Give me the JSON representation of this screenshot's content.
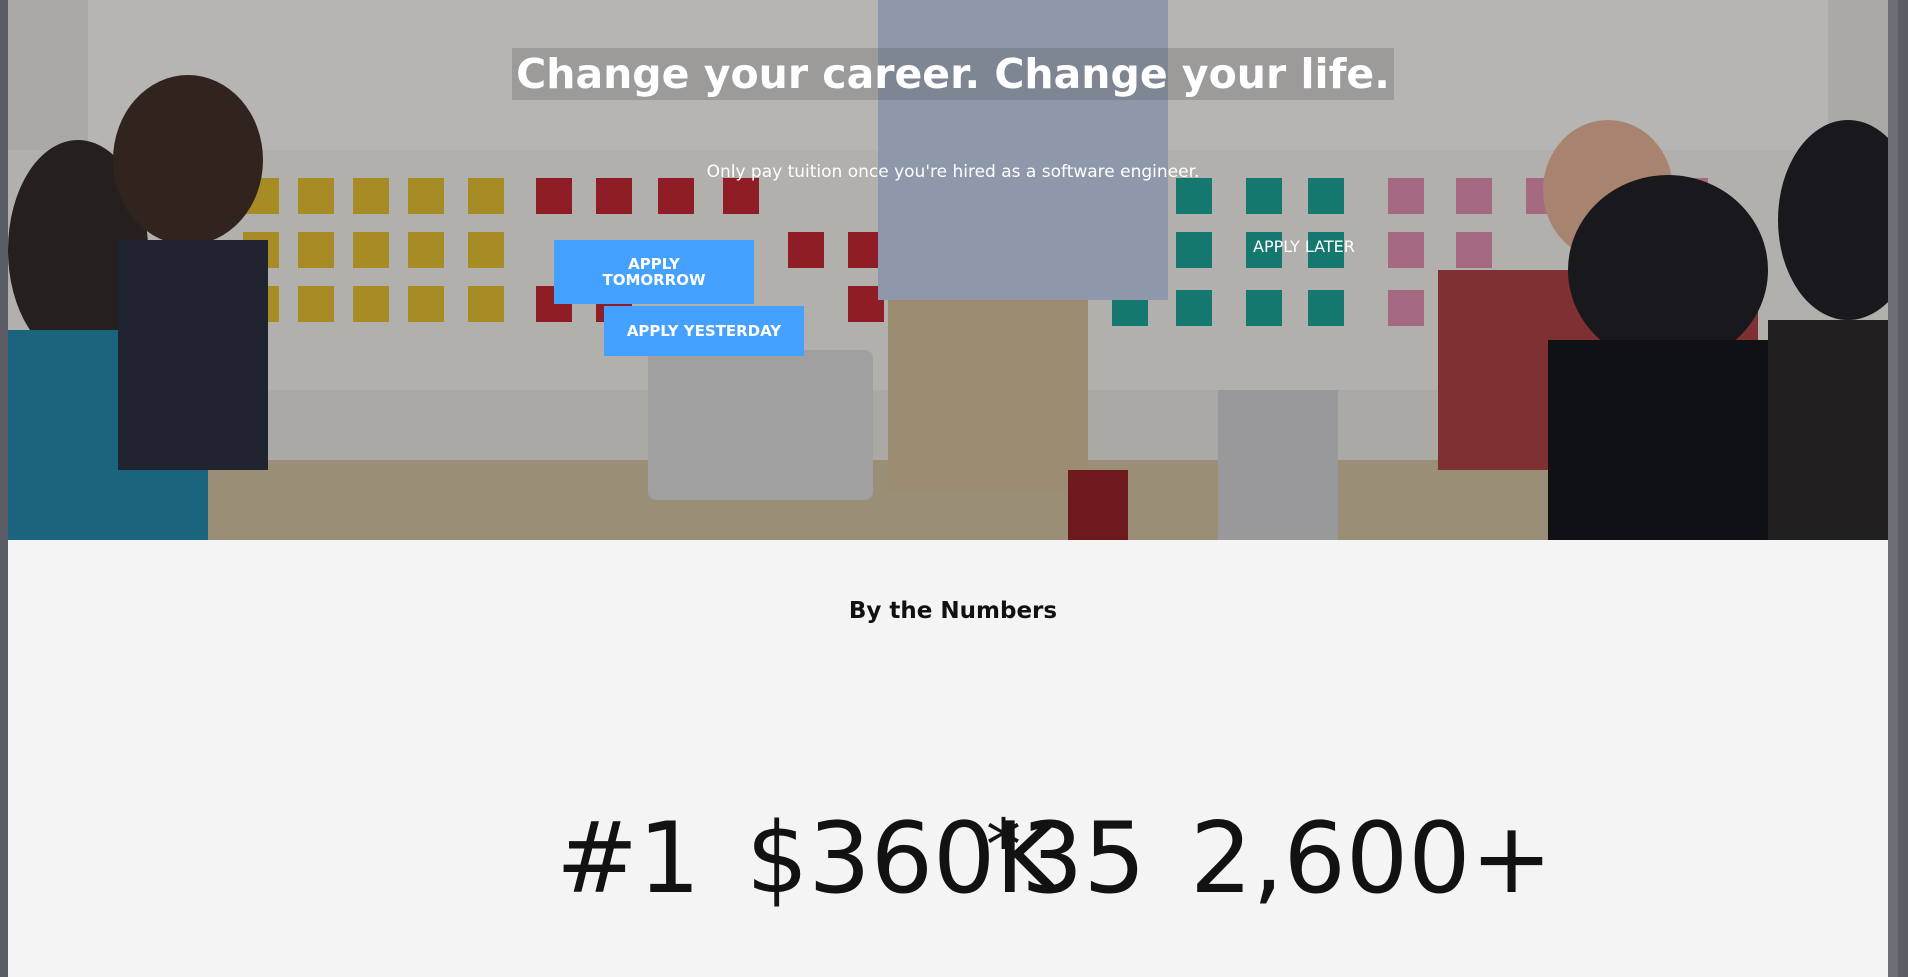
{
  "hero": {
    "title": "Change your career. Change your life.",
    "subtitle": "Only pay tuition once you're hired as a software engineer.",
    "buttons": {
      "apply_tomorrow": "APPLY TOMORROW",
      "apply_yesterday": "APPLY YESTERDAY",
      "apply_later": "APPLY LATER"
    },
    "photo": "classroom-meeting-photo"
  },
  "numbers": {
    "title": "By the Numbers",
    "stats": [
      "#1",
      "$360K",
      "35",
      "2,600+"
    ],
    "overlap_glyph": "*"
  },
  "colors": {
    "button": "#45a1ff",
    "section_bg": "#f4f4f4",
    "text": "#121212"
  }
}
